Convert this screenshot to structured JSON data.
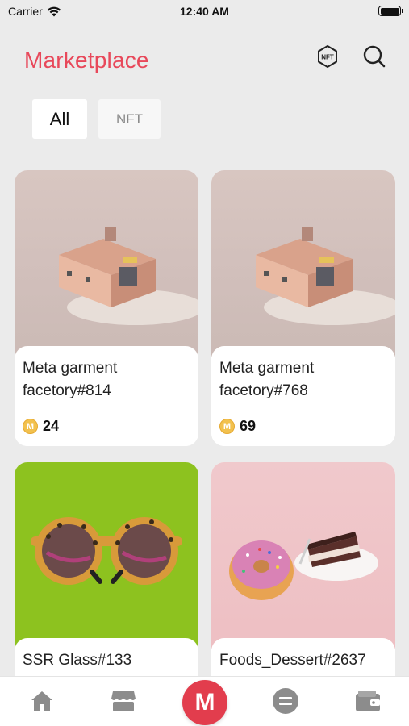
{
  "status_bar": {
    "carrier": "Carrier",
    "time": "12:40 AM"
  },
  "header": {
    "title": "Marketplace",
    "nft_icon_label": "NFT"
  },
  "filters": [
    {
      "label": "All",
      "selected": true
    },
    {
      "label": "NFT",
      "selected": false
    }
  ],
  "cards": [
    {
      "name_line1": "Meta garment",
      "name_line2": "facetory#814",
      "price": "24",
      "image": "garment-factory-building"
    },
    {
      "name_line1": "Meta garment",
      "name_line2": "facetory#768",
      "price": "69",
      "image": "garment-factory-building"
    },
    {
      "name_line1": "SSR Glass#133",
      "name_line2": "",
      "price": "",
      "image": "leopard-sunglasses"
    },
    {
      "name_line1": "Foods_Dessert#2637",
      "name_line2": "",
      "price": "",
      "image": "donut-and-cake"
    }
  ],
  "coin_symbol": "M",
  "tabbar": {
    "center_label": "M",
    "tabs": [
      "home-icon",
      "store-icon",
      "marketplace-icon",
      "exchange-icon",
      "wallet-icon"
    ]
  },
  "colors": {
    "accent": "#e8485a",
    "coin": "#f2c14e",
    "background": "#ebebeb"
  }
}
